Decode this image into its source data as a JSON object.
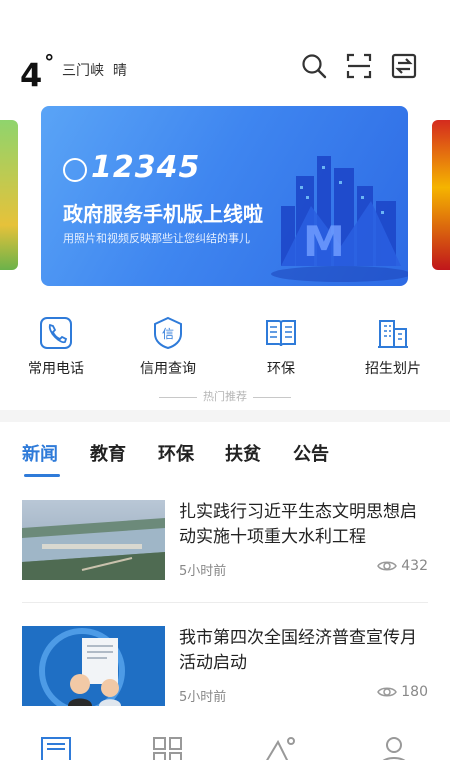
{
  "header": {
    "temperature": "4",
    "degree": "°",
    "city": "三门峡",
    "weather": "晴",
    "icons": [
      "search-icon",
      "scan-icon",
      "toggle-icon"
    ]
  },
  "banner": {
    "hotline": "12345",
    "headline": "政府服务手机版上线啦",
    "subline": "用照片和视频反映那些让您纠结的事儿"
  },
  "quick_links": [
    {
      "label": "常用电话",
      "icon": "phone-icon"
    },
    {
      "label": "信用查询",
      "icon": "credit-icon"
    },
    {
      "label": "环保",
      "icon": "book-icon"
    },
    {
      "label": "招生划片",
      "icon": "building-icon"
    }
  ],
  "hot_label": "热门推荐",
  "tabs": [
    "新闻",
    "教育",
    "环保",
    "扶贫",
    "公告"
  ],
  "active_tab": "新闻",
  "news": [
    {
      "title": "扎实践行习近平生态文明思想启动实施十项重大水利工程",
      "time": "5小时前",
      "views": "432"
    },
    {
      "title": "我市第四次全国经济普查宣传月活动启动",
      "time": "5小时前",
      "views": "180"
    }
  ],
  "bottom_nav_icons": [
    "news-icon",
    "apps-icon",
    "scenery-icon",
    "profile-icon"
  ],
  "colors": {
    "accent": "#2f7bd9",
    "banner": "#3f86f0",
    "icon": "#2f7bd9"
  }
}
